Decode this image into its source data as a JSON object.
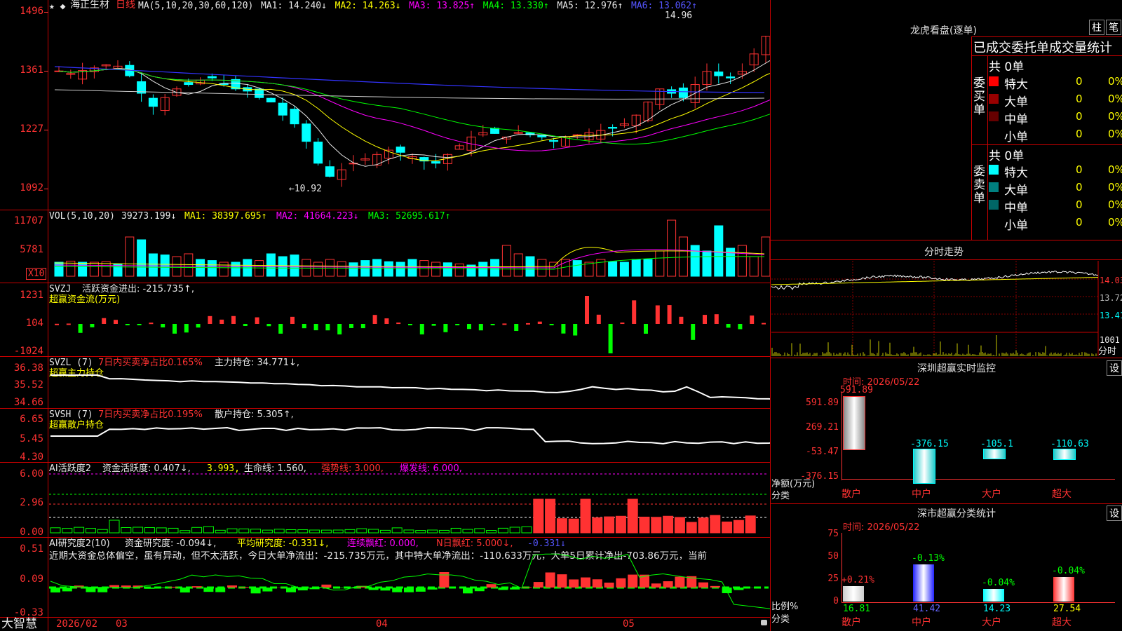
{
  "kline": {
    "stock_name": "海正生材",
    "period": "日线",
    "ma_params": "MA(5,10,20,30,60,120)",
    "ma_values": [
      {
        "label": "MA1: 14.240↓",
        "color": "#e8e8e8"
      },
      {
        "label": "MA2: 14.263↓",
        "color": "#ffff00"
      },
      {
        "label": "MA3: 13.825↑",
        "color": "#ff00ff"
      },
      {
        "label": "MA4: 13.330↑",
        "color": "#00ff00"
      },
      {
        "label": "MA5: 12.976↑",
        "color": "#e8e8e8"
      },
      {
        "label": "MA6: 13.062↑",
        "color": "#5555ff"
      }
    ],
    "y_ticks": [
      "1496",
      "1361",
      "1227",
      "1092"
    ],
    "high_label": "14.96",
    "low_label": "←10.92"
  },
  "vol": {
    "header": "VOL(5,10,20)",
    "value": "39273.199↓",
    "ma1": "MA1: 38397.695↑",
    "ma2": "MA2: 41664.223↓",
    "ma3": "MA3: 52695.617↑",
    "y_ticks": [
      "11707",
      "5781"
    ],
    "unit": "X10"
  },
  "svzj": {
    "header": "SVZJ",
    "line": "活跃资金进出: -215.735↑,",
    "sub": "超赢资金流(万元)",
    "y_ticks": [
      "1231",
      "104",
      "-1024"
    ]
  },
  "svzl": {
    "header": "SVZL (7)",
    "ratio": "7日内买卖净占比0.165%",
    "hold": "主力持仓: 34.771↓,",
    "sub": "超赢主力持仓",
    "y_ticks": [
      "36.38",
      "35.52",
      "34.66"
    ]
  },
  "svsh": {
    "header": "SVSH (7)",
    "ratio": "7日内买卖净占比0.195%",
    "hold": "散户持仓: 5.305↑,",
    "sub": "超赢散户持仓",
    "y_ticks": [
      "6.65",
      "5.45",
      "4.30"
    ]
  },
  "ai_active": {
    "header": "AI活跃度2",
    "line1": "资金活跃度: 0.407↓,",
    "line2": "3.993,",
    "line3": "生命线: 1.560,",
    "line4": "强势线: 3.000,",
    "line5": "爆发线: 6.000,",
    "y_ticks": [
      "6.00",
      "2.96",
      "0.00"
    ]
  },
  "ai_research": {
    "header": "AI研究度2(10)",
    "line1": "资金研究度: -0.094↓,",
    "line2": "平均研究度: -0.331↓,",
    "line3": "连续飘红: 0.000,",
    "line4": "N日飘红: 5.000↓,",
    "line5": "-0.331↓",
    "comment": "近期大资金总体偏空，虽有异动，但不太活跃，今日大单净流出：-215.735万元，其中特大单净流出：-110.633万元，大单5日累计净出-703.86万元，当前",
    "y_ticks": [
      "0.51",
      "0.09",
      "-0.33"
    ]
  },
  "xaxis": {
    "app": "大智慧",
    "labels": [
      "2026/02",
      "03",
      "04",
      "05"
    ]
  },
  "longhu": {
    "title": "龙虎看盘(逐单)",
    "btn1": "柱",
    "btn2": "笔",
    "tabs": "已成交委托单成交量统计",
    "buy_total": "共 0单",
    "buy_label": "委买单",
    "sell_total": "共 0单",
    "sell_label": "委卖单",
    "buy_rows": [
      {
        "name": "特大",
        "count": "0",
        "pct": "0%",
        "color": "#ff0000"
      },
      {
        "name": "大单",
        "count": "0",
        "pct": "0%",
        "color": "#990000"
      },
      {
        "name": "中单",
        "count": "0",
        "pct": "0%",
        "color": "#660000"
      },
      {
        "name": "小单",
        "count": "0",
        "pct": "0%",
        "color": "#000000"
      }
    ],
    "sell_rows": [
      {
        "name": "特大",
        "count": "0",
        "pct": "0%",
        "color": "#00ffff"
      },
      {
        "name": "大单",
        "count": "0",
        "pct": "0%",
        "color": "#008080"
      },
      {
        "name": "中单",
        "count": "0",
        "pct": "0%",
        "color": "#006666"
      },
      {
        "name": "小单",
        "count": "0",
        "pct": "0%",
        "color": "#000000"
      }
    ]
  },
  "intraday": {
    "title": "分时走势",
    "y_ticks": [
      "14.03",
      "13.72",
      "13.41"
    ],
    "vol_tick": "1001",
    "vol_label": "分时"
  },
  "sz_monitor": {
    "title": "深圳超赢实时监控",
    "set_btn": "设",
    "time_label": "时间: 2026/05/22",
    "y_ticks": [
      "591.89",
      "269.21",
      "-53.47",
      "-376.15"
    ],
    "y_unit": "净额(万元)",
    "x_unit": "分类",
    "bars": [
      {
        "name": "散户",
        "value": 591.89,
        "label": "591.89"
      },
      {
        "name": "中户",
        "value": -376.15,
        "label": "-376.15"
      },
      {
        "name": "大户",
        "value": -105.1,
        "label": "-105.1"
      },
      {
        "name": "超大",
        "value": -110.63,
        "label": "-110.63"
      }
    ]
  },
  "sh_stats": {
    "title": "深市超赢分类统计",
    "set_btn": "设",
    "time_label": "时间: 2026/05/22",
    "y_ticks": [
      "75",
      "50",
      "25",
      "0"
    ],
    "y_unit": "比例%",
    "x_unit": "分类",
    "bars": [
      {
        "name": "散户",
        "value": 16.81,
        "label": "16.81",
        "delta": "+0.21%",
        "delta_color": "#ff3232",
        "color": "#cccccc"
      },
      {
        "name": "中户",
        "value": 41.42,
        "label": "41.42",
        "delta": "-0.13%",
        "delta_color": "#00ff00",
        "color": "#2222ff"
      },
      {
        "name": "大户",
        "value": 14.23,
        "label": "14.23",
        "delta": "-0.04%",
        "delta_color": "#00ff00",
        "color": "#00ffff"
      },
      {
        "name": "超大",
        "value": 27.54,
        "label": "27.54",
        "delta": "-0.04%",
        "delta_color": "#00ff00",
        "color": "#ff3232"
      }
    ]
  }
}
